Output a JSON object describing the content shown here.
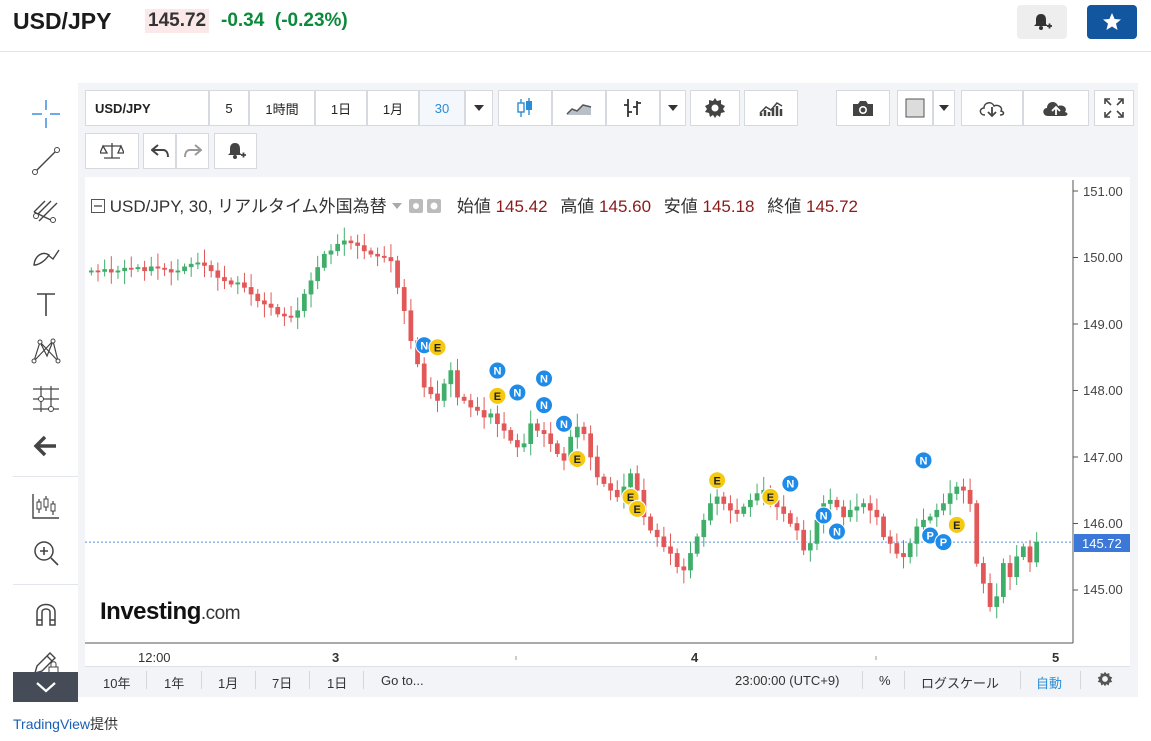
{
  "header": {
    "symbol": "USD/JPY",
    "price": "145.72",
    "change": "-0.34",
    "change_pct": "(-0.23%)"
  },
  "toolbar": {
    "symbol_field": "USD/JPY",
    "intervals": [
      "5",
      "1時間",
      "1日",
      "1月",
      "30"
    ]
  },
  "chart_data": {
    "type": "candlestick",
    "legend": {
      "title": "USD/JPY, 30, リアルタイム外国為替",
      "open_label": "始値",
      "open": "145.42",
      "high_label": "高値",
      "high": "145.60",
      "low_label": "安値",
      "low": "145.18",
      "close_label": "終値",
      "close": "145.72"
    },
    "ylim": [
      144.3,
      151.2
    ],
    "y_ticks": [
      "151.00",
      "150.00",
      "149.00",
      "148.00",
      "147.00",
      "146.00",
      "145.00"
    ],
    "current_price": "145.72",
    "x_ticks": [
      {
        "label": "12:00",
        "pos": 0.07
      },
      {
        "label": "3",
        "pos": 0.25
      },
      {
        "label": "4",
        "pos": 0.61
      },
      {
        "label": "5",
        "pos": 0.97
      }
    ],
    "close": [
      149.8,
      149.79,
      149.82,
      149.78,
      149.8,
      149.84,
      149.83,
      149.85,
      149.8,
      149.86,
      149.84,
      149.82,
      149.78,
      149.8,
      149.86,
      149.9,
      149.92,
      149.88,
      149.8,
      149.7,
      149.65,
      149.6,
      149.62,
      149.55,
      149.45,
      149.35,
      149.3,
      149.25,
      149.15,
      149.12,
      149.1,
      149.2,
      149.45,
      149.65,
      149.85,
      150.05,
      150.1,
      150.2,
      150.25,
      150.22,
      150.18,
      150.1,
      150.05,
      150.02,
      150.0,
      149.95,
      149.55,
      149.2,
      148.75,
      148.4,
      148.05,
      147.95,
      147.85,
      148.1,
      148.3,
      147.9,
      147.85,
      147.75,
      147.7,
      147.6,
      147.65,
      147.5,
      147.4,
      147.25,
      147.15,
      147.2,
      147.5,
      147.4,
      147.35,
      147.2,
      147.05,
      146.95,
      147.3,
      147.45,
      147.35,
      147.0,
      146.7,
      146.6,
      146.5,
      146.4,
      146.55,
      146.75,
      146.5,
      146.1,
      145.9,
      145.8,
      145.65,
      145.55,
      145.35,
      145.3,
      145.55,
      145.8,
      146.05,
      146.3,
      146.4,
      146.3,
      146.2,
      146.15,
      146.25,
      146.35,
      146.45,
      146.5,
      146.35,
      146.25,
      146.15,
      146.0,
      145.9,
      145.6,
      145.7,
      146.05,
      146.3,
      146.35,
      146.25,
      146.1,
      146.2,
      146.25,
      146.3,
      146.2,
      146.1,
      145.8,
      145.7,
      145.55,
      145.5,
      145.7,
      145.95,
      146.05,
      146.1,
      146.2,
      146.3,
      146.45,
      146.55,
      146.5,
      146.3,
      145.4,
      145.1,
      144.75,
      144.9,
      145.4,
      145.2,
      145.5,
      145.65,
      145.42,
      145.72
    ],
    "markers": [
      {
        "i": 50,
        "price": 148.68,
        "label": "N"
      },
      {
        "i": 52,
        "price": 148.65,
        "label": "E"
      },
      {
        "i": 61,
        "price": 148.3,
        "label": "N"
      },
      {
        "i": 61,
        "price": 147.92,
        "label": "E"
      },
      {
        "i": 64,
        "price": 147.97,
        "label": "N"
      },
      {
        "i": 68,
        "price": 148.18,
        "label": "N"
      },
      {
        "i": 68,
        "price": 147.78,
        "label": "N"
      },
      {
        "i": 71,
        "price": 147.5,
        "label": "N"
      },
      {
        "i": 73,
        "price": 146.97,
        "label": "E"
      },
      {
        "i": 81,
        "price": 146.4,
        "label": "E"
      },
      {
        "i": 82,
        "price": 146.22,
        "label": "E"
      },
      {
        "i": 94,
        "price": 146.65,
        "label": "E"
      },
      {
        "i": 102,
        "price": 146.4,
        "label": "E"
      },
      {
        "i": 105,
        "price": 146.6,
        "label": "N"
      },
      {
        "i": 110,
        "price": 146.12,
        "label": "N"
      },
      {
        "i": 112,
        "price": 145.88,
        "label": "N"
      },
      {
        "i": 125,
        "price": 146.95,
        "label": "N"
      },
      {
        "i": 126,
        "price": 145.82,
        "label": "P"
      },
      {
        "i": 128,
        "price": 145.72,
        "label": "P"
      },
      {
        "i": 130,
        "price": 145.98,
        "label": "E"
      }
    ]
  },
  "bottom": {
    "ranges": [
      "10年",
      "1年",
      "1月",
      "7日",
      "1日",
      "Go to..."
    ],
    "time": "23:00:00",
    "tz": "(UTC+9)",
    "pct": "%",
    "log": "ログスケール",
    "auto": "自動"
  },
  "logo": {
    "main": "Investing",
    "suffix": ".com"
  },
  "credit": {
    "link": "TradingView",
    "suffix": "提供"
  },
  "colors": {
    "up": "#3fae6a",
    "down": "#e25757",
    "accent": "#1256a0",
    "news": "#1e8be8",
    "event": "#f5c90f"
  }
}
